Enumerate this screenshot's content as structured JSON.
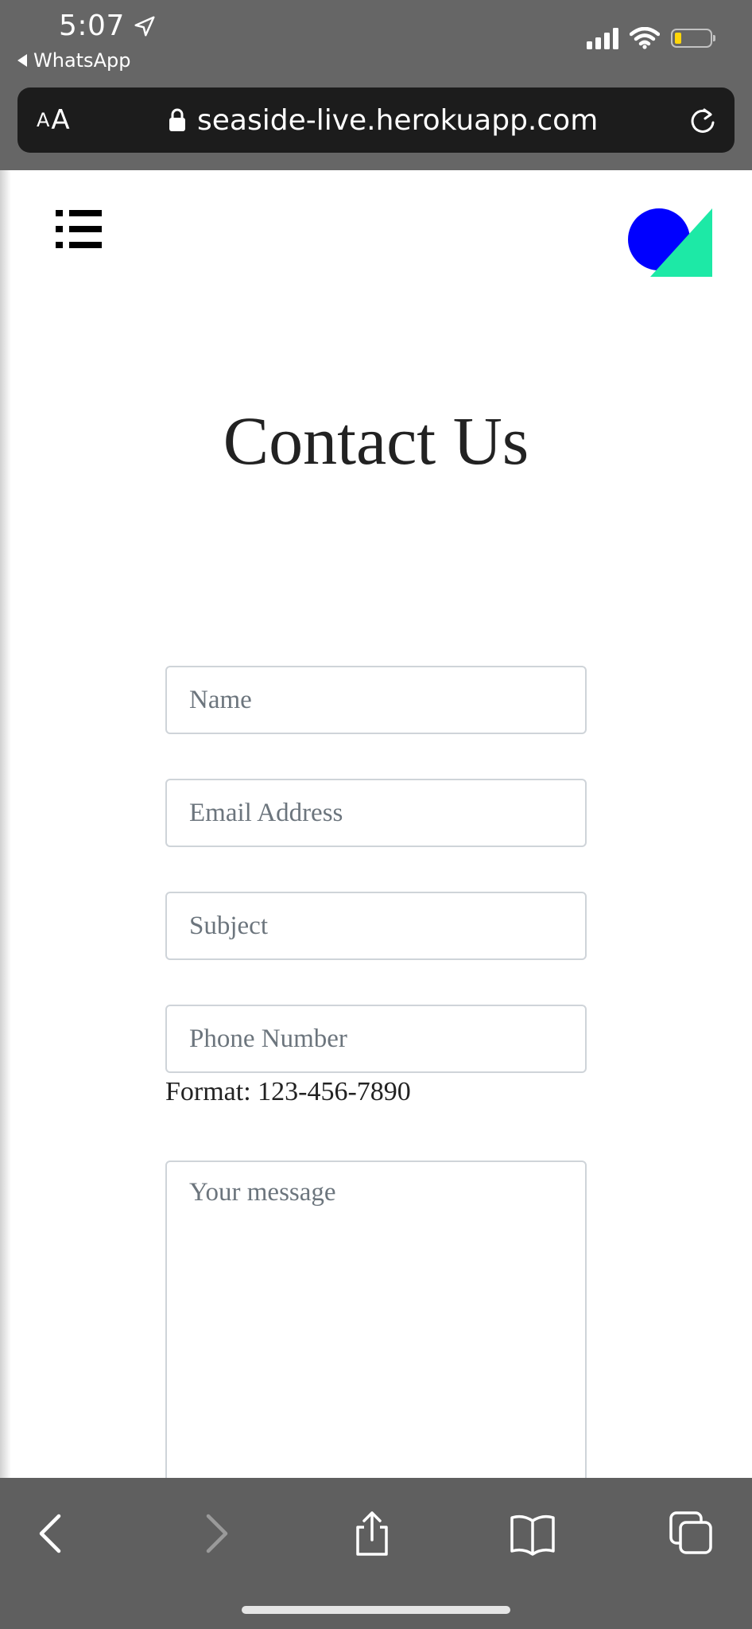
{
  "status_bar": {
    "time": "5:07",
    "back_app": "WhatsApp"
  },
  "browser": {
    "text_size_label_small": "A",
    "text_size_label_large": "A",
    "url": "seaside-live.herokuapp.com"
  },
  "page": {
    "title": "Contact Us",
    "form": {
      "name_placeholder": "Name",
      "email_placeholder": "Email Address",
      "subject_placeholder": "Subject",
      "phone_placeholder": "Phone Number",
      "phone_hint": "Format: 123-456-7890",
      "message_placeholder": "Your message"
    },
    "logo_colors": {
      "circle": "#0000ff",
      "triangle": "#1de9a6"
    }
  },
  "toolbar_icons": [
    "back-icon",
    "forward-icon",
    "share-icon",
    "bookmarks-icon",
    "tabs-icon"
  ]
}
